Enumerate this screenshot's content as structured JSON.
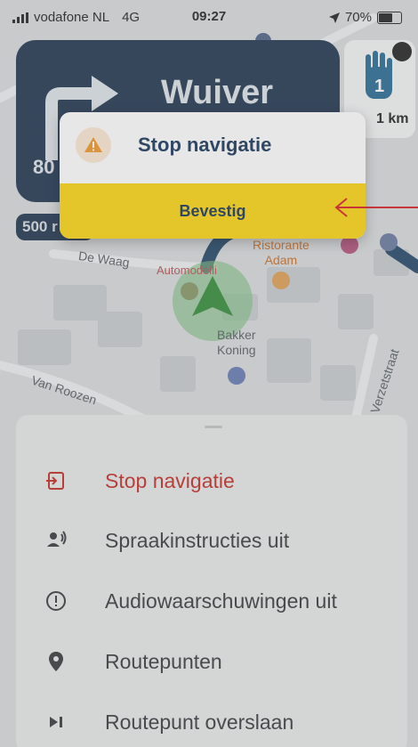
{
  "status_bar": {
    "carrier": "vodafone NL",
    "network": "4G",
    "time": "09:27",
    "battery_percent": "70%",
    "battery_level": 0.7
  },
  "navigation": {
    "street_name": "Wuiver",
    "distance_partial": "80",
    "speed_chip": "500 r",
    "sign_distance": "1 km",
    "sign_number": "1"
  },
  "map_labels": {
    "de_waag": "De Waag",
    "automodelli": "Automodelli",
    "ristorante": "Ristorante\nAdam",
    "bakker": "Bakker\nKoning",
    "van_roozen": "Van Roozen",
    "verzetstraat": "Verzetstraat"
  },
  "dialog": {
    "title": "Stop navigatie",
    "confirm_label": "Bevestig",
    "warning_color": "#f29a2e",
    "button_color": "#fcd71a"
  },
  "menu": {
    "items": [
      {
        "label": "Stop navigatie",
        "icon": "exit-icon",
        "color": "#c4332d"
      },
      {
        "label": "Spraakinstructies uit",
        "icon": "voice-icon"
      },
      {
        "label": "Audiowaarschuwingen uit",
        "icon": "alert-icon"
      },
      {
        "label": "Routepunten",
        "icon": "location-pin-icon"
      },
      {
        "label": "Routepunt overslaan",
        "icon": "skip-next-icon"
      }
    ]
  }
}
